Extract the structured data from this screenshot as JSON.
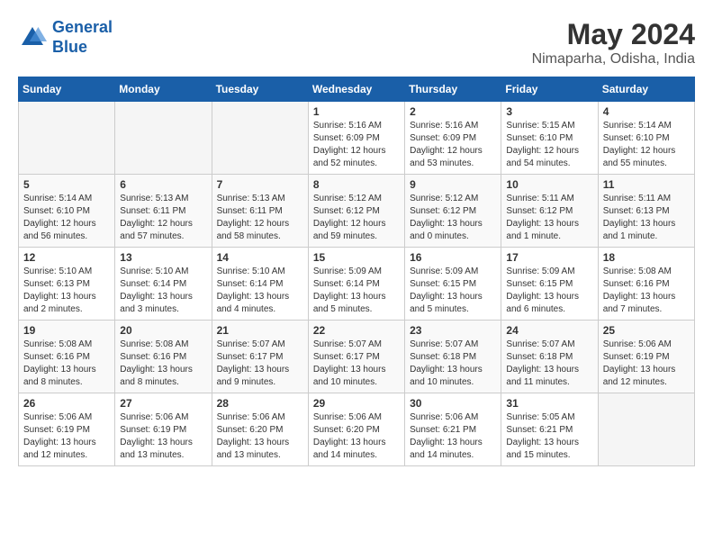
{
  "header": {
    "logo_line1": "General",
    "logo_line2": "Blue",
    "title": "May 2024",
    "subtitle": "Nimaparha, Odisha, India"
  },
  "days_of_week": [
    "Sunday",
    "Monday",
    "Tuesday",
    "Wednesday",
    "Thursday",
    "Friday",
    "Saturday"
  ],
  "weeks": [
    [
      {
        "day": "",
        "info": ""
      },
      {
        "day": "",
        "info": ""
      },
      {
        "day": "",
        "info": ""
      },
      {
        "day": "1",
        "info": "Sunrise: 5:16 AM\nSunset: 6:09 PM\nDaylight: 12 hours\nand 52 minutes."
      },
      {
        "day": "2",
        "info": "Sunrise: 5:16 AM\nSunset: 6:09 PM\nDaylight: 12 hours\nand 53 minutes."
      },
      {
        "day": "3",
        "info": "Sunrise: 5:15 AM\nSunset: 6:10 PM\nDaylight: 12 hours\nand 54 minutes."
      },
      {
        "day": "4",
        "info": "Sunrise: 5:14 AM\nSunset: 6:10 PM\nDaylight: 12 hours\nand 55 minutes."
      }
    ],
    [
      {
        "day": "5",
        "info": "Sunrise: 5:14 AM\nSunset: 6:10 PM\nDaylight: 12 hours\nand 56 minutes."
      },
      {
        "day": "6",
        "info": "Sunrise: 5:13 AM\nSunset: 6:11 PM\nDaylight: 12 hours\nand 57 minutes."
      },
      {
        "day": "7",
        "info": "Sunrise: 5:13 AM\nSunset: 6:11 PM\nDaylight: 12 hours\nand 58 minutes."
      },
      {
        "day": "8",
        "info": "Sunrise: 5:12 AM\nSunset: 6:12 PM\nDaylight: 12 hours\nand 59 minutes."
      },
      {
        "day": "9",
        "info": "Sunrise: 5:12 AM\nSunset: 6:12 PM\nDaylight: 13 hours\nand 0 minutes."
      },
      {
        "day": "10",
        "info": "Sunrise: 5:11 AM\nSunset: 6:12 PM\nDaylight: 13 hours\nand 1 minute."
      },
      {
        "day": "11",
        "info": "Sunrise: 5:11 AM\nSunset: 6:13 PM\nDaylight: 13 hours\nand 1 minute."
      }
    ],
    [
      {
        "day": "12",
        "info": "Sunrise: 5:10 AM\nSunset: 6:13 PM\nDaylight: 13 hours\nand 2 minutes."
      },
      {
        "day": "13",
        "info": "Sunrise: 5:10 AM\nSunset: 6:14 PM\nDaylight: 13 hours\nand 3 minutes."
      },
      {
        "day": "14",
        "info": "Sunrise: 5:10 AM\nSunset: 6:14 PM\nDaylight: 13 hours\nand 4 minutes."
      },
      {
        "day": "15",
        "info": "Sunrise: 5:09 AM\nSunset: 6:14 PM\nDaylight: 13 hours\nand 5 minutes."
      },
      {
        "day": "16",
        "info": "Sunrise: 5:09 AM\nSunset: 6:15 PM\nDaylight: 13 hours\nand 5 minutes."
      },
      {
        "day": "17",
        "info": "Sunrise: 5:09 AM\nSunset: 6:15 PM\nDaylight: 13 hours\nand 6 minutes."
      },
      {
        "day": "18",
        "info": "Sunrise: 5:08 AM\nSunset: 6:16 PM\nDaylight: 13 hours\nand 7 minutes."
      }
    ],
    [
      {
        "day": "19",
        "info": "Sunrise: 5:08 AM\nSunset: 6:16 PM\nDaylight: 13 hours\nand 8 minutes."
      },
      {
        "day": "20",
        "info": "Sunrise: 5:08 AM\nSunset: 6:16 PM\nDaylight: 13 hours\nand 8 minutes."
      },
      {
        "day": "21",
        "info": "Sunrise: 5:07 AM\nSunset: 6:17 PM\nDaylight: 13 hours\nand 9 minutes."
      },
      {
        "day": "22",
        "info": "Sunrise: 5:07 AM\nSunset: 6:17 PM\nDaylight: 13 hours\nand 10 minutes."
      },
      {
        "day": "23",
        "info": "Sunrise: 5:07 AM\nSunset: 6:18 PM\nDaylight: 13 hours\nand 10 minutes."
      },
      {
        "day": "24",
        "info": "Sunrise: 5:07 AM\nSunset: 6:18 PM\nDaylight: 13 hours\nand 11 minutes."
      },
      {
        "day": "25",
        "info": "Sunrise: 5:06 AM\nSunset: 6:19 PM\nDaylight: 13 hours\nand 12 minutes."
      }
    ],
    [
      {
        "day": "26",
        "info": "Sunrise: 5:06 AM\nSunset: 6:19 PM\nDaylight: 13 hours\nand 12 minutes."
      },
      {
        "day": "27",
        "info": "Sunrise: 5:06 AM\nSunset: 6:19 PM\nDaylight: 13 hours\nand 13 minutes."
      },
      {
        "day": "28",
        "info": "Sunrise: 5:06 AM\nSunset: 6:20 PM\nDaylight: 13 hours\nand 13 minutes."
      },
      {
        "day": "29",
        "info": "Sunrise: 5:06 AM\nSunset: 6:20 PM\nDaylight: 13 hours\nand 14 minutes."
      },
      {
        "day": "30",
        "info": "Sunrise: 5:06 AM\nSunset: 6:21 PM\nDaylight: 13 hours\nand 14 minutes."
      },
      {
        "day": "31",
        "info": "Sunrise: 5:05 AM\nSunset: 6:21 PM\nDaylight: 13 hours\nand 15 minutes."
      },
      {
        "day": "",
        "info": ""
      }
    ]
  ]
}
